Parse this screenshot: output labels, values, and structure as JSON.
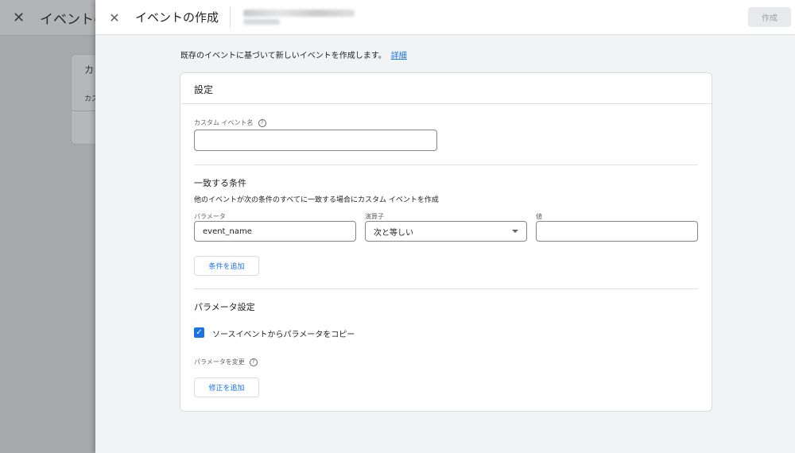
{
  "background": {
    "title": "イベントの",
    "card_title": "カ",
    "card_sub": "カス"
  },
  "panel": {
    "title": "イベントの作成",
    "create_label": "作成"
  },
  "intro": {
    "text": "既存のイベントに基づいて新しいイベントを作成します。",
    "link": "詳細"
  },
  "settings": {
    "title": "設定",
    "custom_event_name_label": "カスタム イベント名",
    "custom_event_name_value": "",
    "match": {
      "title": "一致する条件",
      "description": "他のイベントが次の条件のすべてに一致する場合にカスタム イベントを作成",
      "parameter_label": "パラメータ",
      "parameter_value": "event_name",
      "operator_label": "演算子",
      "operator_value": "次と等しい",
      "value_label": "値",
      "value_value": "",
      "add_condition": "条件を追加"
    },
    "param_settings": {
      "title": "パラメータ設定",
      "copy_label": "ソースイベントからパラメータをコピー",
      "copy_checked": true,
      "modify_label": "パラメータを変更",
      "add_modification": "修正を追加"
    }
  },
  "colors": {
    "accent": "#1a73e8",
    "panel_bg": "#f1f3f4"
  }
}
